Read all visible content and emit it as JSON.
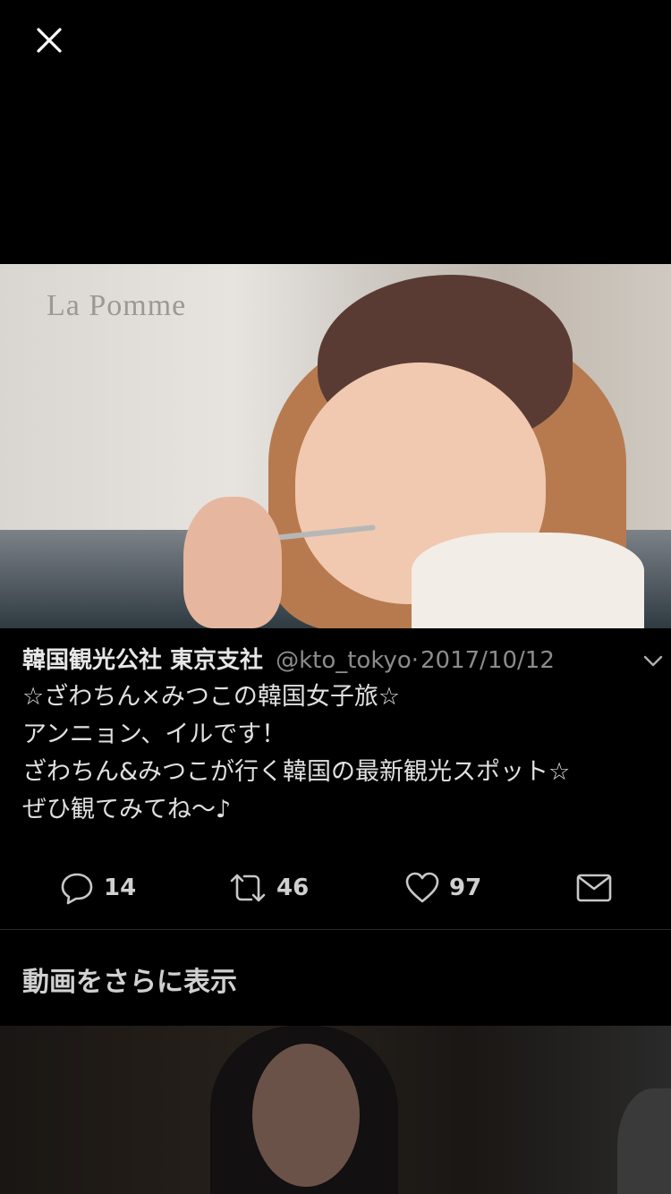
{
  "video": {
    "watermark": "La Pomme"
  },
  "tweet": {
    "author": "韓国観光公社 東京支社",
    "handle": "@kto_tokyo",
    "separator": "·",
    "date": "2017/10/12",
    "lines": [
      "☆ざわちん×みつこの韓国女子旅☆",
      "アンニョン、イルです！",
      "ざわちん&みつこが行く韓国の最新観光スポット☆",
      "ぜひ観てみてね〜♪"
    ]
  },
  "actions": {
    "reply_count": "14",
    "retweet_count": "46",
    "like_count": "97"
  },
  "more_videos_label": "動画をさらに表示",
  "icons": {
    "close": "close-icon",
    "chevron": "chevron-down-icon",
    "reply": "reply-icon",
    "retweet": "retweet-icon",
    "like": "heart-icon",
    "message": "envelope-icon"
  }
}
